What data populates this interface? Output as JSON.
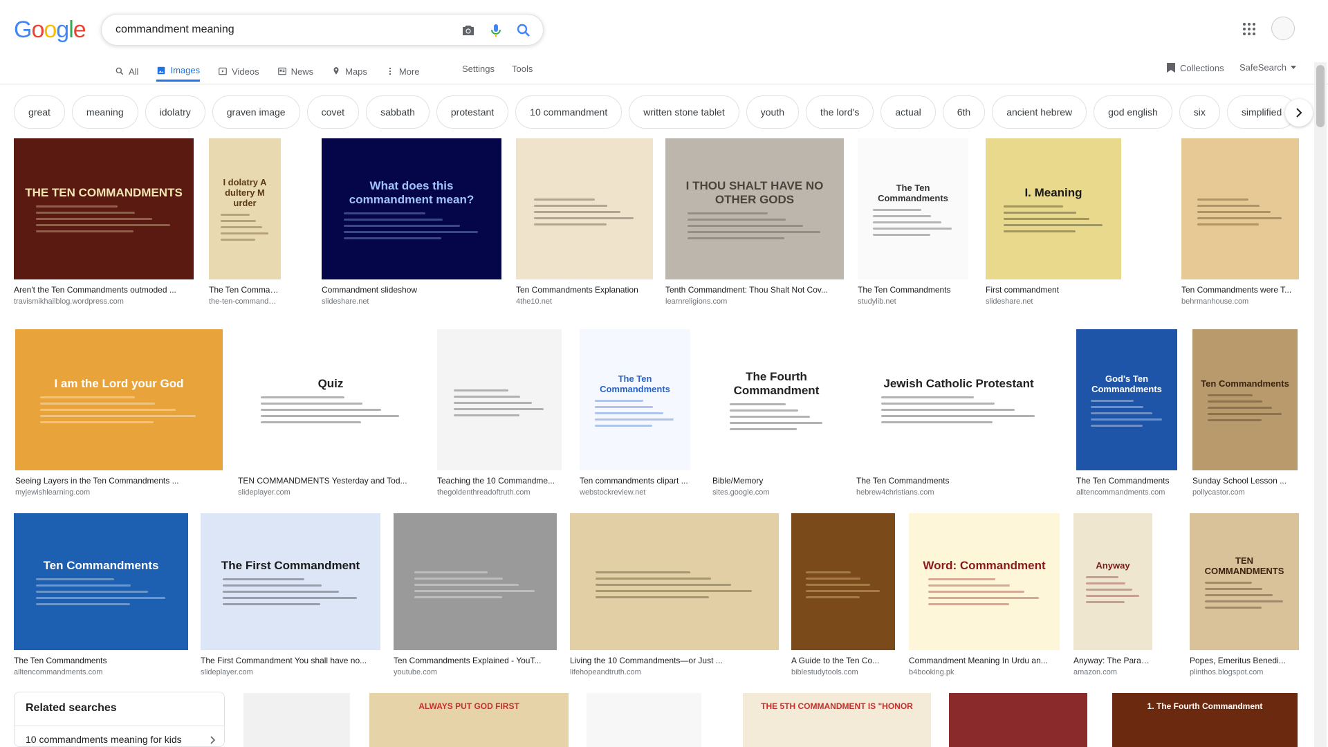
{
  "logo": "Google",
  "search": {
    "query": "commandment meaning"
  },
  "tabs": [
    {
      "label": "All",
      "icon": "search-icon",
      "active": false
    },
    {
      "label": "Images",
      "icon": "image-icon",
      "active": true
    },
    {
      "label": "Videos",
      "icon": "video-icon",
      "active": false
    },
    {
      "label": "News",
      "icon": "news-icon",
      "active": false
    },
    {
      "label": "Maps",
      "icon": "maps-icon",
      "active": false
    },
    {
      "label": "More",
      "icon": "more-vert-icon",
      "active": false
    }
  ],
  "settings_label": "Settings",
  "tools_label": "Tools",
  "collections_label": "Collections",
  "safesearch_label": "SafeSearch",
  "chips": [
    "great",
    "meaning",
    "idolatry",
    "graven image",
    "covet",
    "sabbath",
    "protestant",
    "10 commandment",
    "written stone tablet",
    "youth",
    "the lord's",
    "actual",
    "6th",
    "ancient hebrew",
    "god english",
    "six",
    "simplified"
  ],
  "rows": [
    [
      {
        "caption": "Aren't the Ten Commandments outmoded ...",
        "source": "travismikhailblog.wordpress.com",
        "bg": "#5a1a12",
        "text": "THE TEN COMMANDMENTS",
        "fg": "#f3e6b3"
      },
      {
        "caption": "The Ten Commandme...",
        "source": "the-ten-commandments....",
        "bg": "#e8d9b0",
        "text": "I dolatry  A dultery  M urder",
        "fg": "#5a3b1a"
      },
      {
        "caption": "Commandment slideshow",
        "source": "slideshare.net",
        "bg": "#05064a",
        "text": "What does this commandment mean?",
        "fg": "#9fc3ff"
      },
      {
        "caption": "Ten Commandments Explanation",
        "source": "4the10.net",
        "bg": "#efe3cc",
        "text": "",
        "fg": "#3b3024"
      },
      {
        "caption": "Tenth Commandment: Thou Shalt Not Cov...",
        "source": "learnreligions.com",
        "bg": "#bdb6ad",
        "text": "I THOU SHALT HAVE NO OTHER GODS",
        "fg": "#4a443c"
      },
      {
        "caption": "The Ten Commandments",
        "source": "studylib.net",
        "bg": "#fafafa",
        "text": "The Ten Commandments",
        "fg": "#333333"
      },
      {
        "caption": "First commandment",
        "source": "slideshare.net",
        "bg": "#e9d98c",
        "text": "I. Meaning",
        "fg": "#1a1a1a"
      },
      {
        "caption": "Ten Commandments were T...",
        "source": "behrmanhouse.com",
        "bg": "#e6c995",
        "text": "",
        "fg": "#4a2e10"
      }
    ],
    [
      {
        "caption": "Seeing Layers in the Ten Commandments ...",
        "source": "myjewishlearning.com",
        "bg": "#e8a43a",
        "text": "I am the Lord your God",
        "fg": "#ffffff"
      },
      {
        "caption": "TEN COMMANDMENTS Yesterday and Tod...",
        "source": "slideplayer.com",
        "bg": "#ffffff",
        "text": "Quiz",
        "fg": "#222222"
      },
      {
        "caption": "Teaching the 10 Commandme...",
        "source": "thegoldenthreadoftruth.com",
        "bg": "#f4f4f4",
        "text": "",
        "fg": "#333333"
      },
      {
        "caption": "Ten commandments clipart ...",
        "source": "webstockreview.net",
        "bg": "#f5f8ff",
        "text": "The Ten Commandments",
        "fg": "#2a63c4"
      },
      {
        "caption": "Bible/Memory",
        "source": "sites.google.com",
        "bg": "#ffffff",
        "text": "The Fourth Commandment",
        "fg": "#222222"
      },
      {
        "caption": "The Ten Commandments",
        "source": "hebrew4christians.com",
        "bg": "#ffffff",
        "text": "Jewish  Catholic  Protestant",
        "fg": "#222222"
      },
      {
        "caption": "The Ten Commandments",
        "source": "alltencommandments.com",
        "bg": "#1f55a8",
        "text": "God's Ten Commandments",
        "fg": "#ffffff"
      },
      {
        "caption": "Sunday School Lesson ...",
        "source": "pollycastor.com",
        "bg": "#b89a6c",
        "text": "Ten Commandments",
        "fg": "#3a2410"
      }
    ],
    [
      {
        "caption": "The Ten Commandments",
        "source": "alltencommandments.com",
        "bg": "#1d5fb0",
        "text": "Ten Commandments",
        "fg": "#ffffff"
      },
      {
        "caption": "The First Commandment You shall have no...",
        "source": "slideplayer.com",
        "bg": "#dde6f7",
        "text": "The First Commandment",
        "fg": "#1a1a1a"
      },
      {
        "caption": "Ten Commandments Explained - YouT...",
        "source": "youtube.com",
        "bg": "#9a9a9a",
        "text": "",
        "fg": "#ffffff"
      },
      {
        "caption": "Living the 10 Commandments—or Just ...",
        "source": "lifehopeandtruth.com",
        "bg": "#e2cfa6",
        "text": "",
        "fg": "#3a2a12"
      },
      {
        "caption": "A Guide to the Ten Co...",
        "source": "biblestudytools.com",
        "bg": "#7a4a1a",
        "text": "",
        "fg": "#f5d99a"
      },
      {
        "caption": "Commandment Meaning In Urdu an...",
        "source": "b4booking.pk",
        "bg": "#fdf6d8",
        "text": "Word: Commandment",
        "fg": "#8a1a1a"
      },
      {
        "caption": "Anyway: The Paradoxi...",
        "source": "amazon.com",
        "bg": "#efe6cf",
        "text": "Anyway",
        "fg": "#7a1a1a"
      },
      {
        "caption": "Popes, Emeritus Benedi...",
        "source": "plinthos.blogspot.com",
        "bg": "#d9c199",
        "text": "TEN COMMANDMENTS",
        "fg": "#3a2410"
      }
    ]
  ],
  "related": {
    "title": "Related searches",
    "items": [
      "10 commandments meaning for kids"
    ]
  },
  "bottom_thumbs": [
    {
      "bg": "#f1f1f1",
      "text": ""
    },
    {
      "bg": "#e6d4a8",
      "text": "ALWAYS PUT GOD FIRST"
    },
    {
      "bg": "#f7f7f7",
      "text": ""
    },
    {
      "bg": "#f3ead7",
      "text": "THE 5TH COMMANDMENT IS \"HONOR"
    },
    {
      "bg": "#8a2a2a",
      "text": ""
    },
    {
      "bg": "#6b2a10",
      "text": "1. The Fourth Commandment"
    }
  ]
}
